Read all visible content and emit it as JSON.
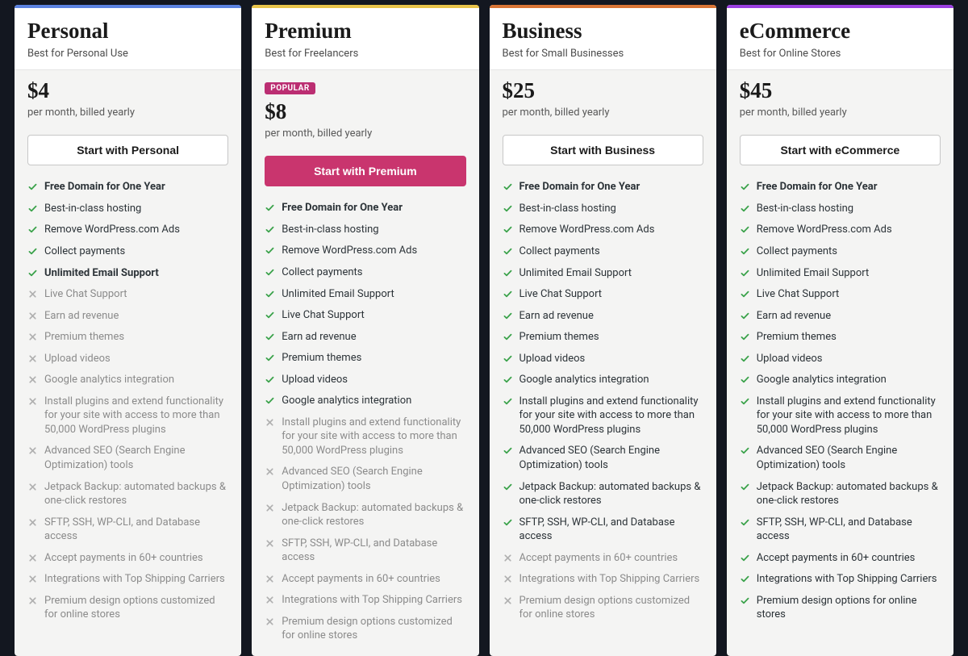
{
  "labels": {
    "billing": "per month, billed yearly",
    "popular": "POPULAR",
    "cta_prefix": "Start with "
  },
  "features": [
    {
      "text": "Free Domain for One Year",
      "bold": true
    },
    {
      "text": "Best-in-class hosting"
    },
    {
      "text": "Remove WordPress.com Ads"
    },
    {
      "text": "Collect payments"
    },
    {
      "text": "Unlimited Email Support",
      "bold_for": [
        "personal"
      ]
    },
    {
      "text": "Live Chat Support"
    },
    {
      "text": "Earn ad revenue"
    },
    {
      "text": "Premium themes"
    },
    {
      "text": "Upload videos"
    },
    {
      "text": "Google analytics integration"
    },
    {
      "text": "Install plugins and extend functionality for your site with access to more than 50,000 WordPress plugins"
    },
    {
      "text": "Advanced SEO (Search Engine Optimization) tools"
    },
    {
      "text": "Jetpack Backup: automated backups & one-click restores"
    },
    {
      "text": "SFTP, SSH, WP-CLI, and Database access"
    },
    {
      "text": "Accept payments in 60+ countries"
    },
    {
      "text": "Integrations with Top Shipping Carriers"
    },
    {
      "text_default": "Premium design options customized for online stores",
      "text_for": {
        "ecommerce": "Premium design options for online stores"
      }
    }
  ],
  "plans": [
    {
      "id": "personal",
      "name": "Personal",
      "tagline": "Best for Personal Use",
      "price": "$4",
      "bar": "blue",
      "popular": false,
      "cta_filled": false,
      "included": [
        true,
        true,
        true,
        true,
        true,
        false,
        false,
        false,
        false,
        false,
        false,
        false,
        false,
        false,
        false,
        false,
        false
      ]
    },
    {
      "id": "premium",
      "name": "Premium",
      "tagline": "Best for Freelancers",
      "price": "$8",
      "bar": "yellow",
      "popular": true,
      "cta_filled": true,
      "included": [
        true,
        true,
        true,
        true,
        true,
        true,
        true,
        true,
        true,
        true,
        false,
        false,
        false,
        false,
        false,
        false,
        false
      ]
    },
    {
      "id": "business",
      "name": "Business",
      "tagline": "Best for Small Businesses",
      "price": "$25",
      "bar": "orange",
      "popular": false,
      "cta_filled": false,
      "included": [
        true,
        true,
        true,
        true,
        true,
        true,
        true,
        true,
        true,
        true,
        true,
        true,
        true,
        true,
        false,
        false,
        false
      ]
    },
    {
      "id": "ecommerce",
      "name": "eCommerce",
      "tagline": "Best for Online Stores",
      "price": "$45",
      "bar": "purple",
      "popular": false,
      "cta_filled": false,
      "included": [
        true,
        true,
        true,
        true,
        true,
        true,
        true,
        true,
        true,
        true,
        true,
        true,
        true,
        true,
        true,
        true,
        true
      ]
    }
  ]
}
